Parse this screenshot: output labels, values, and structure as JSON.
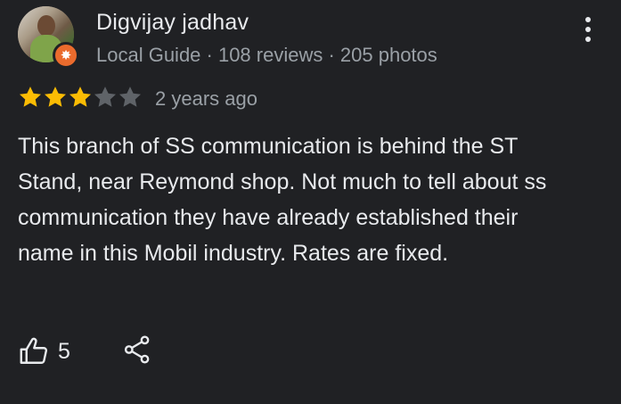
{
  "reviewer": {
    "name": "Digvijay jadhav",
    "meta": "Local Guide · 108 reviews · 205 photos"
  },
  "rating": {
    "stars": 3,
    "max_stars": 5,
    "date": "2 years ago"
  },
  "review": {
    "text": "This branch of SS communication is behind the ST Stand, near Reymond shop. Not much to tell about ss communication they have already established their name in this Mobil industry. Rates are fixed."
  },
  "actions": {
    "like_count": "5"
  },
  "colors": {
    "background": "#202124",
    "star_filled": "#fbbc04",
    "star_empty": "#5f6368",
    "badge": "#ea6b2d"
  },
  "icons": {
    "more": "more-vert-icon",
    "like": "thumbs-up-icon",
    "share": "share-icon",
    "badge": "local-guide-badge-icon"
  }
}
